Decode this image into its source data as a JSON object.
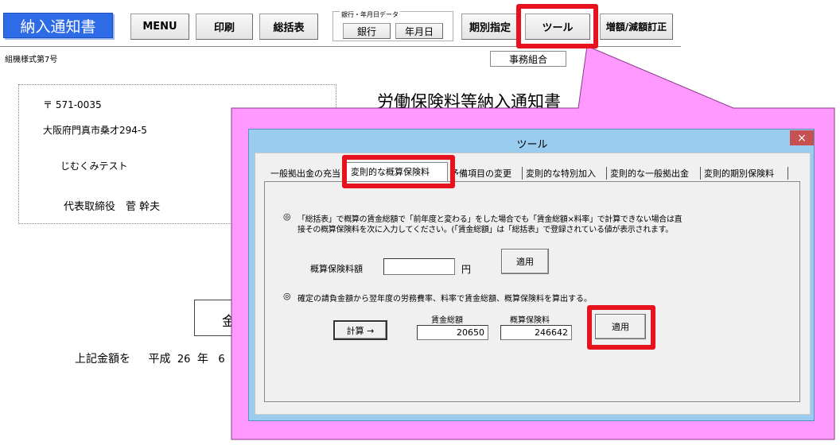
{
  "header": {
    "doc_title_button": "納入通知書",
    "menu": "MENU",
    "print": "印刷",
    "summary": "総括表",
    "bank_group_label": "銀行・年月日データ",
    "bank": "銀行",
    "date": "年月日",
    "period": "期別指定",
    "tools": "ツール",
    "adjust": "増額/減額訂正"
  },
  "form": {
    "form_number": "組機様式第7号",
    "office_label": "事務組合",
    "postal": "〒 571-0035",
    "address": "大阪府門真市桑才294-5",
    "company": "じむくみテスト",
    "representative": "代表取締役　菅 幹夫",
    "doc_heading": "労働保険料等納入通知書",
    "amount_partial": "金",
    "bottom_text_1": "上記金額を",
    "bottom_text_2": "平成",
    "bottom_year": "26",
    "bottom_text_3": "年",
    "bottom_month": "6"
  },
  "dialog": {
    "title": "ツール",
    "close": "×",
    "tabs": [
      "一般拠出金の充当",
      "変則的な概算保険料",
      "予備項目の変更",
      "変則的な特別加入",
      "変則的な一般拠出金",
      "変則的期別保険料"
    ],
    "active_tab": 1,
    "section1_line1": "「総括表」で概算の賃金総額で「前年度と変わる」をした場合でも「賃金総額×料率」で計算できない場合は直",
    "section1_line2": "接その概算保険料を次に入力してください。(「賃金総額」は「総括表」で登録されている値が表示されます。",
    "estimated_premium_label": "概算保険料額",
    "estimated_premium_value": "",
    "yen": "円",
    "apply": "適用",
    "section2_text": "確定の請負金額から翌年度の労務費率、料率で賃金総額、概算保険料を算出する。",
    "calc_button": "計算 →",
    "wage_total_label": "賃金総額",
    "wage_total_value": "20650",
    "premium_label": "概算保険料",
    "premium_value": "246642",
    "apply2": "適用",
    "bullet": "◎"
  },
  "colors": {
    "highlight": "#e8121e",
    "callout": "#ff99ff",
    "dialog_frame": "#99ccee",
    "title_button": "#2e6be6"
  }
}
